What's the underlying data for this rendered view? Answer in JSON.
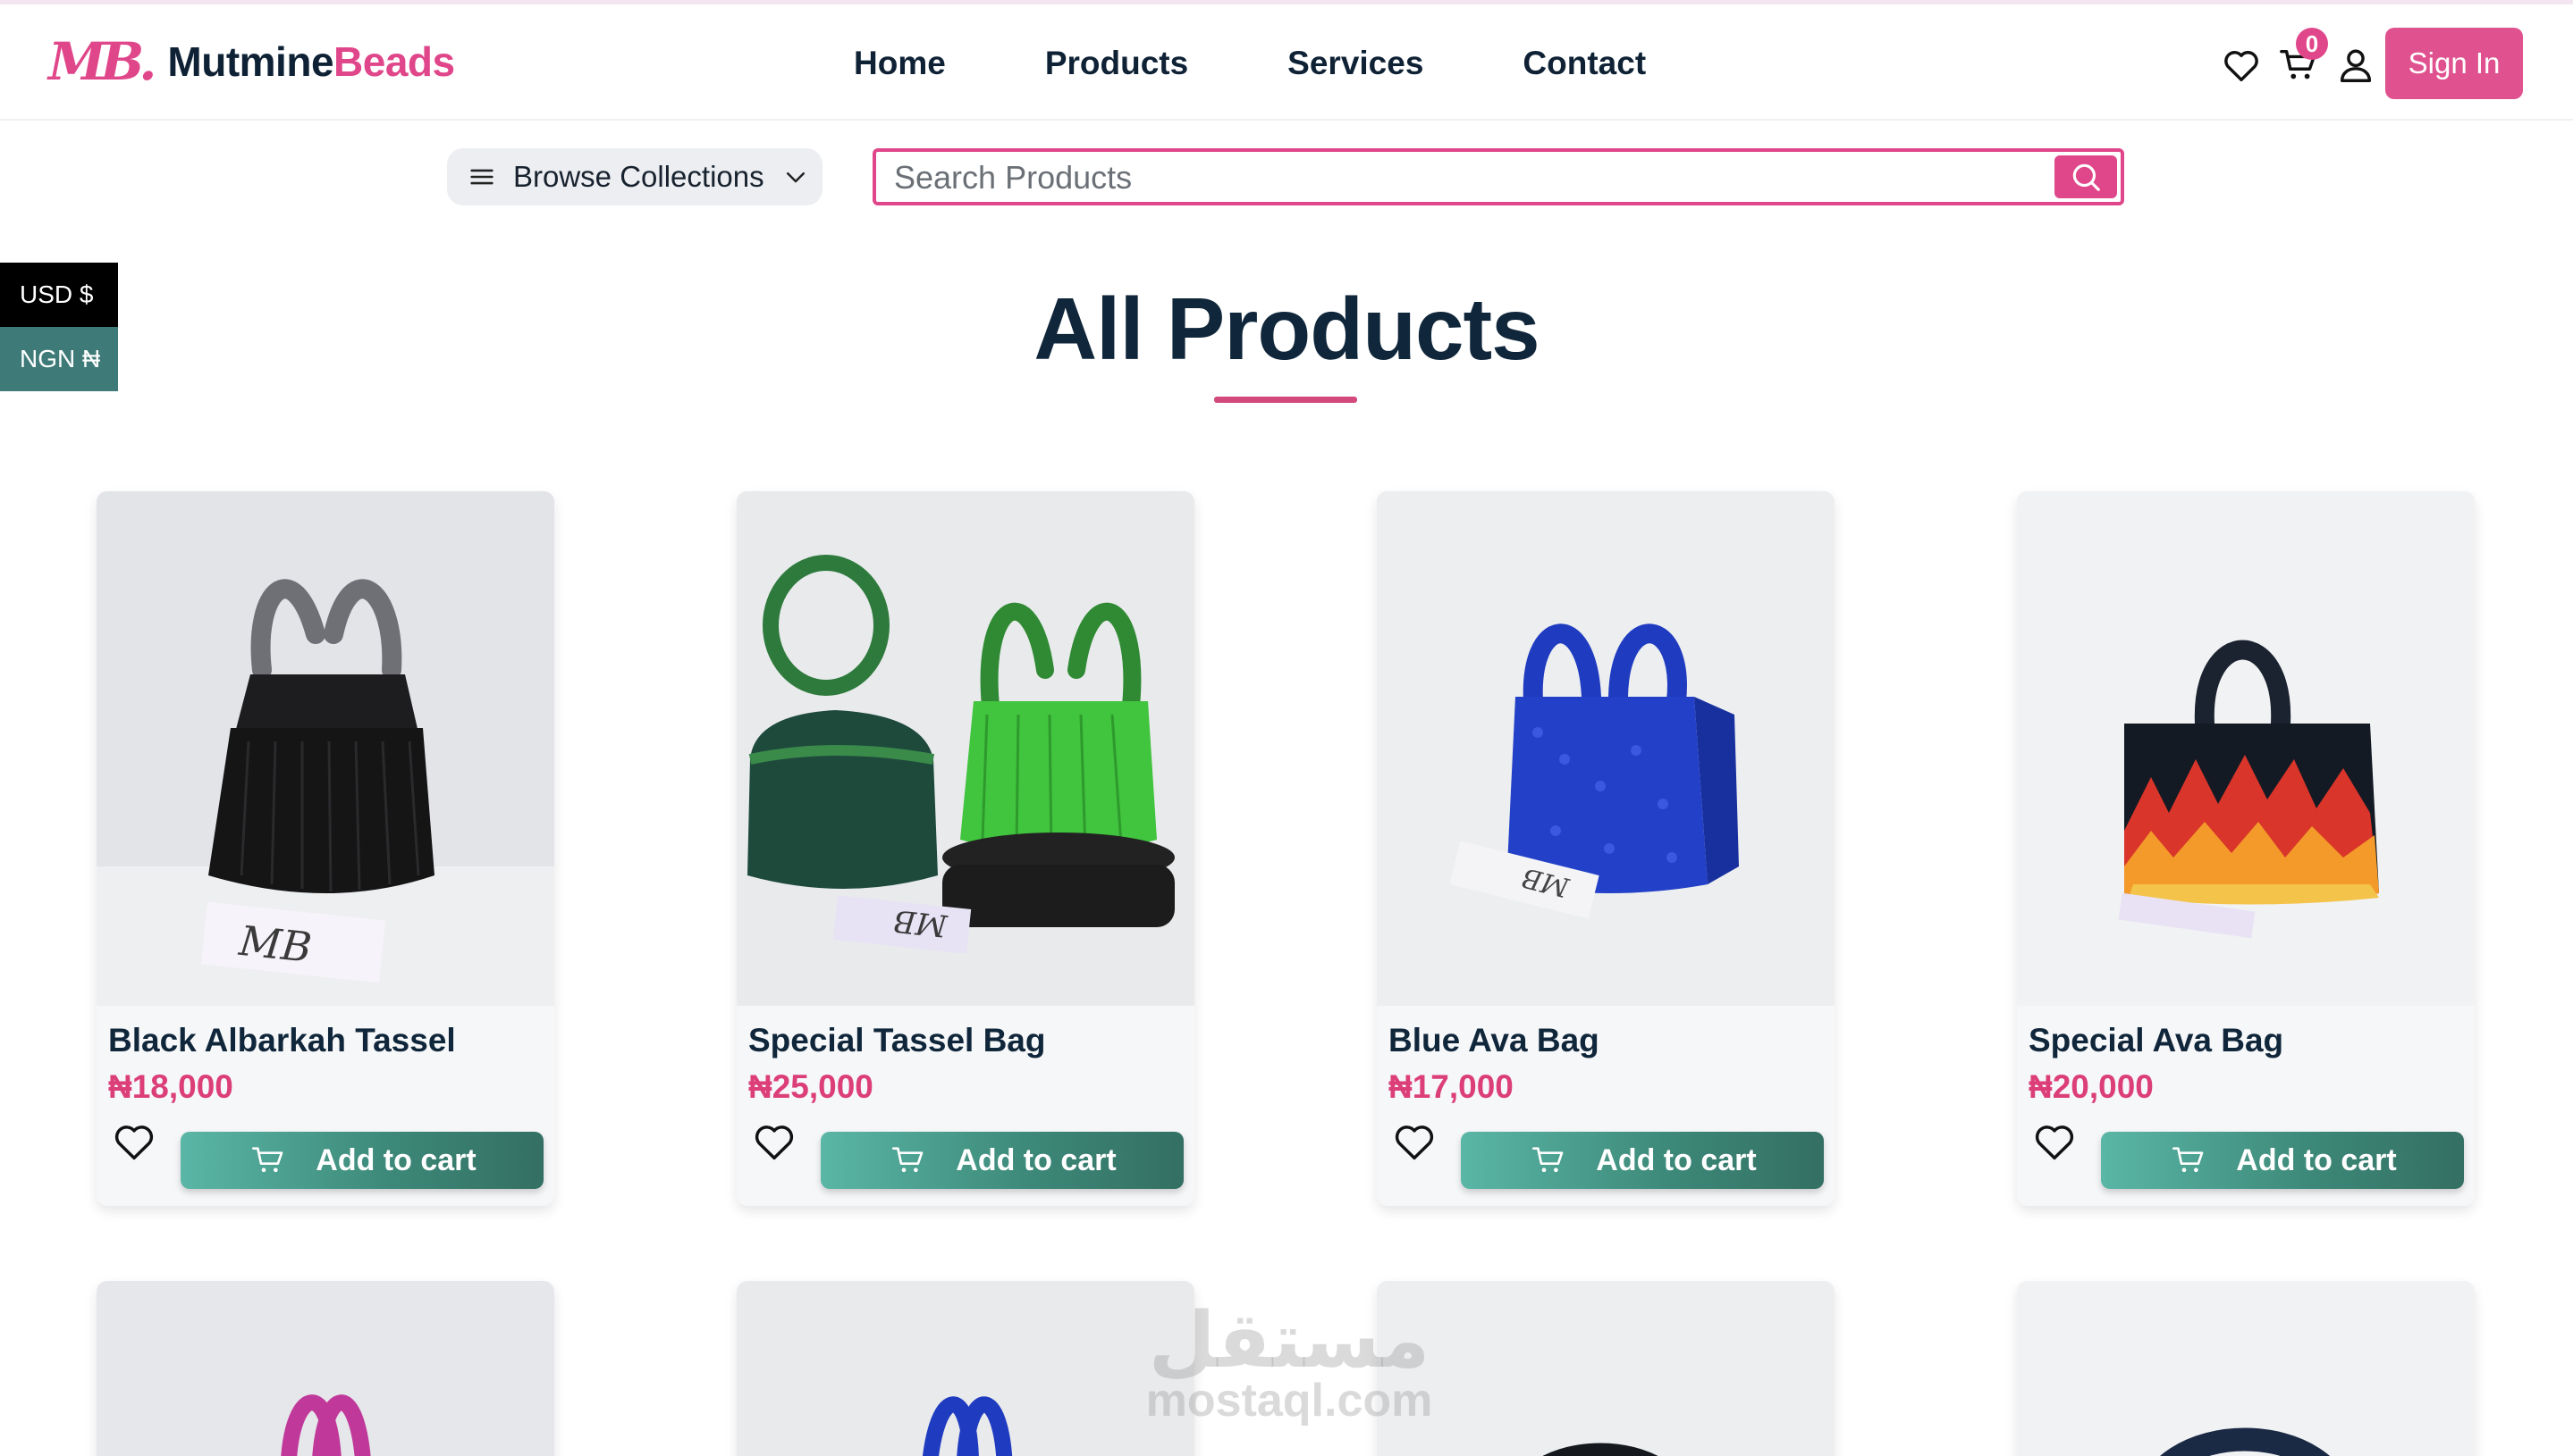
{
  "brand": {
    "mark": "MB.",
    "name_part1": "Mutmine",
    "name_part2": "Beads"
  },
  "nav": [
    "Home",
    "Products",
    "Services",
    "Contact"
  ],
  "header": {
    "cart_count": "0",
    "signin_label": "Sign In"
  },
  "toolbar": {
    "browse_label": "Browse Collections",
    "search_placeholder": "Search Products"
  },
  "currency": [
    "USD $",
    "NGN ₦"
  ],
  "page": {
    "title": "All Products"
  },
  "products": [
    {
      "name": "Black Albarkah Tassel",
      "price": "₦18,000",
      "add_label": "Add to cart"
    },
    {
      "name": "Special Tassel Bag",
      "price": "₦25,000",
      "add_label": "Add to cart"
    },
    {
      "name": "Blue Ava Bag",
      "price": "₦17,000",
      "add_label": "Add to cart"
    },
    {
      "name": "Special Ava Bag",
      "price": "₦20,000",
      "add_label": "Add to cart"
    }
  ],
  "watermark": {
    "arabic": "مستقل",
    "latin": "mostaql.com"
  },
  "colors": {
    "accent": "#e0468a",
    "teal": "#3c8777",
    "navy": "#10263a"
  }
}
